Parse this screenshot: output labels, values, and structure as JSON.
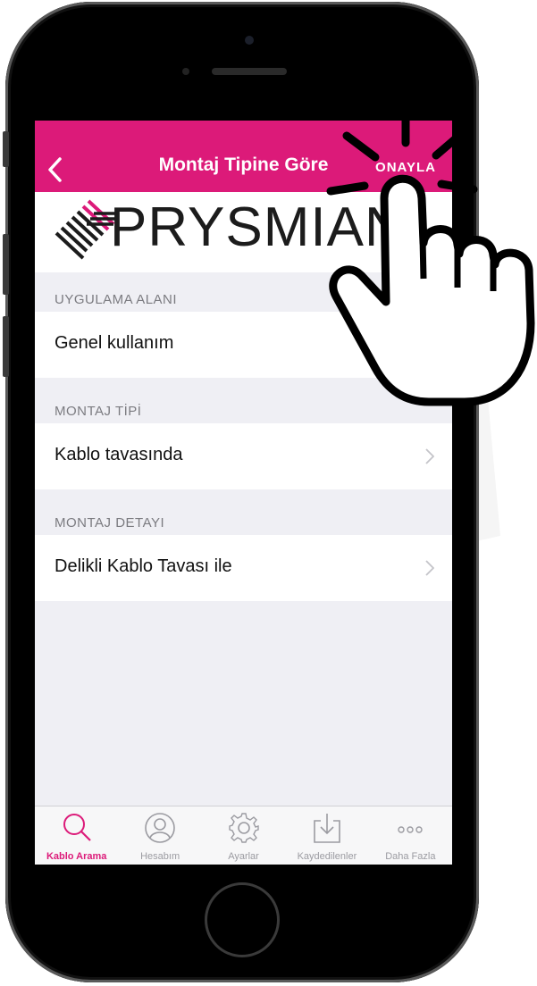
{
  "nav": {
    "title": "Montaj Tipine Göre",
    "right_label": "ONAYLA",
    "back_icon": "chevron-left-icon"
  },
  "brand": {
    "logo_text": "PRYSMIAN",
    "color": "#dc1a79"
  },
  "sections": [
    {
      "header": "UYGULAMA ALANI",
      "value": "Genel kullanım"
    },
    {
      "header": "MONTAJ TİPİ",
      "value": "Kablo tavasında"
    },
    {
      "header": "MONTAJ DETAYI",
      "value": "Delikli Kablo Tavası ile"
    }
  ],
  "tabbar": {
    "tabs": [
      {
        "label": "Kablo Arama",
        "icon": "search-icon",
        "active": true
      },
      {
        "label": "Hesabım",
        "icon": "user-icon",
        "active": false
      },
      {
        "label": "Ayarlar",
        "icon": "gear-icon",
        "active": false
      },
      {
        "label": "Kaydedilenler",
        "icon": "download-icon",
        "active": false
      },
      {
        "label": "Daha Fazla",
        "icon": "more-icon",
        "active": false
      }
    ]
  }
}
